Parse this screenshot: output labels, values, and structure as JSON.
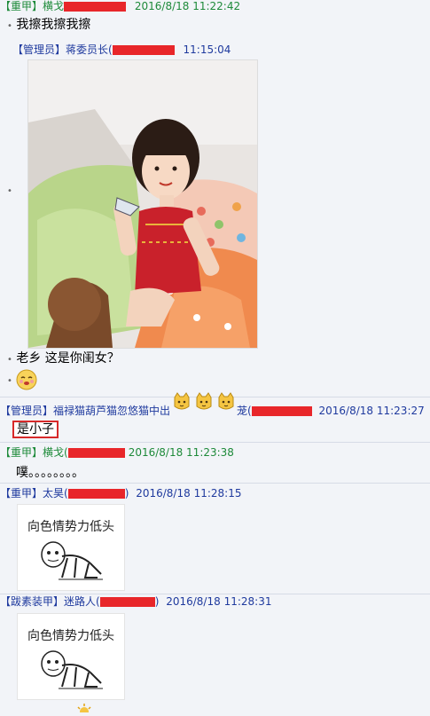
{
  "messages": [
    {
      "tag": "【重甲】",
      "name": "横戈",
      "time": "2016/8/18 11:22:42",
      "text": "我擦我擦我擦"
    },
    {
      "tag": "【管理员】",
      "name": "蒋委员长(",
      "time": "11:15:04"
    },
    {
      "text": "老乡 这是你闺女？"
    },
    {
      "tag": "【管理员】",
      "name": "福禄猫葫芦猫忽悠猫中出",
      "name_suffix": "茏(",
      "time": "2016/8/18 11:23:27",
      "text": "是小子"
    },
    {
      "tag": "【重甲】",
      "name": "横戈(",
      "time": "2016/8/18 11:23:38",
      "text": "噗。。。。。。。。"
    },
    {
      "tag": "【重甲】",
      "name": "太昊(",
      "name_close": ")",
      "time": "2016/8/18 11:28:15",
      "sticker_caption": "向色情势力低头"
    },
    {
      "tag": "【跋素装甲】",
      "name": "迷路人(",
      "name_close": ")",
      "time": "2016/8/18 11:28:31",
      "sticker_caption": "向色情势力低头"
    }
  ],
  "colors": {
    "green": "#1e8a3a",
    "blue": "#1f3a9e",
    "redact": "#e8262a",
    "highlight_border": "#d72a2a"
  },
  "icons": [
    "cat-emoji-icon",
    "cat-emoji-icon",
    "cat-emoji-icon",
    "shy-face-emoji-icon",
    "sun-emoji-icon"
  ]
}
